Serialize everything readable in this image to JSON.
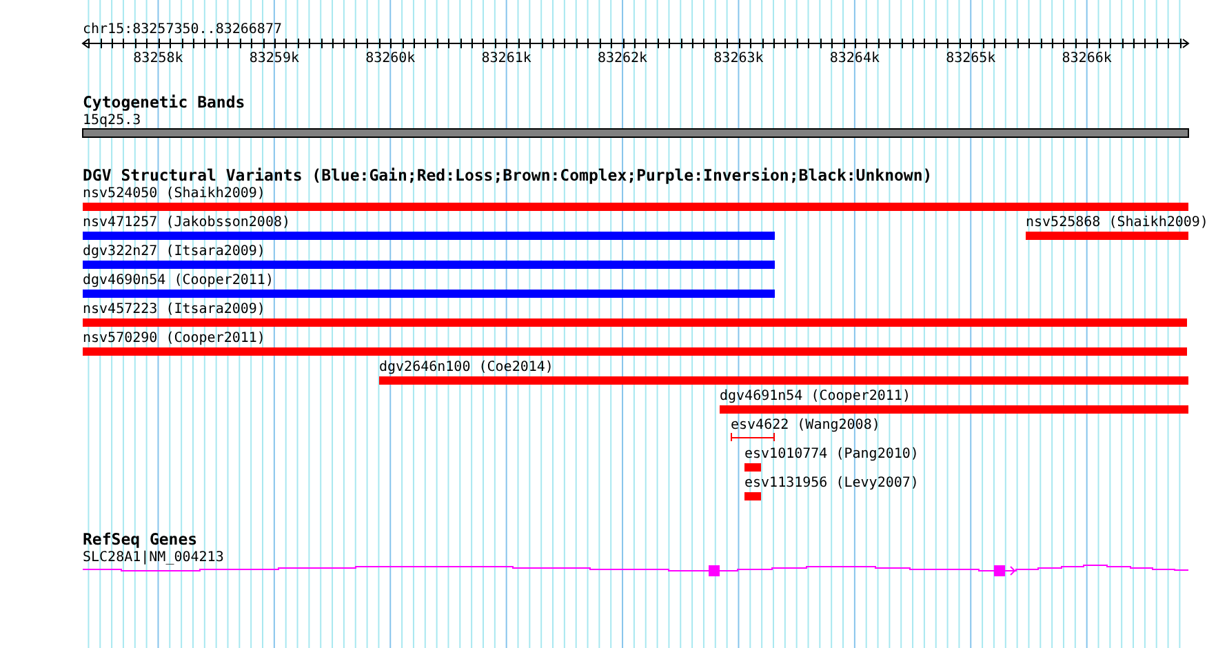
{
  "ruler": {
    "label": "chr15:83257350..83266877",
    "ticks": [
      "83258k",
      "83259k",
      "83260k",
      "83261k",
      "83262k",
      "83263k",
      "83264k",
      "83265k",
      "83266k"
    ]
  },
  "cytogenetic_bands": {
    "title": "Cytogenetic Bands",
    "band": "15q25.3"
  },
  "dgv_structural_variants": {
    "title": "DGV Structural Variants (Blue:Gain;Red:Loss;Brown:Complex;Purple:Inversion;Black:Unknown)",
    "variants": [
      {
        "label": "nsv524050 (Shaikh2009)",
        "color": "#ff0000",
        "kind": "bar"
      },
      {
        "label": "nsv471257 (Jakobsson2008)",
        "color": "#0000ff",
        "kind": "bar"
      },
      {
        "label": "nsv525868 (Shaikh2009)",
        "color": "#ff0000",
        "kind": "bar"
      },
      {
        "label": "dgv322n27 (Itsara2009)",
        "color": "#0000ff",
        "kind": "bar"
      },
      {
        "label": "dgv4690n54 (Cooper2011)",
        "color": "#0000ff",
        "kind": "bar"
      },
      {
        "label": "nsv457223 (Itsara2009)",
        "color": "#ff0000",
        "kind": "bar"
      },
      {
        "label": "nsv570290 (Cooper2011)",
        "color": "#ff0000",
        "kind": "bar"
      },
      {
        "label": "dgv2646n100 (Coe2014)",
        "color": "#ff0000",
        "kind": "bar"
      },
      {
        "label": "dgv4691n54 (Cooper2011)",
        "color": "#ff0000",
        "kind": "bar"
      },
      {
        "label": "esv4622 (Wang2008)",
        "color": "#ff0000",
        "kind": "span"
      },
      {
        "label": "esv1010774 (Pang2010)",
        "color": "#ff0000",
        "kind": "bar"
      },
      {
        "label": "esv1131956 (Levy2007)",
        "color": "#ff0000",
        "kind": "bar"
      }
    ]
  },
  "refseq_genes": {
    "title": "RefSeq Genes",
    "genes": [
      {
        "label": "SLC28A1|NM_004213"
      }
    ]
  }
}
